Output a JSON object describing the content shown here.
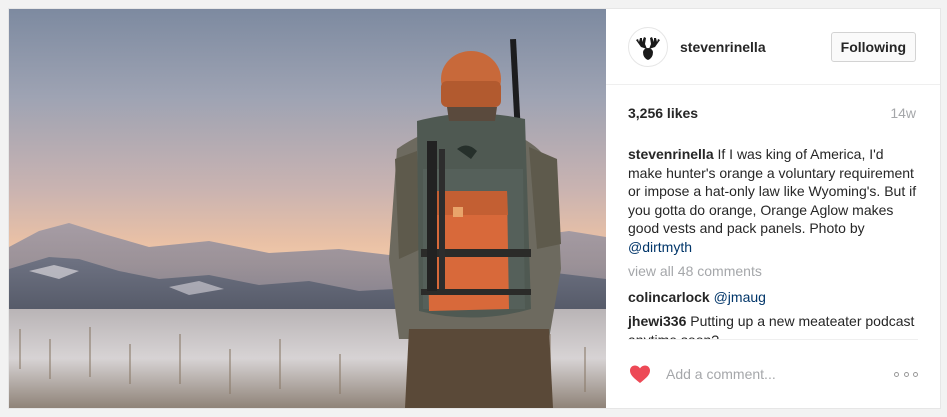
{
  "post": {
    "user": {
      "username": "stevenrinella",
      "avatar_icon": "moose-logo-icon"
    },
    "follow_label": "Following",
    "likes": "3,256 likes",
    "time_ago": "14w",
    "caption": {
      "user": "stevenrinella",
      "text": "If I was king of America, I'd make hunter's orange a voluntary requirement or impose a hat-only law like Wyoming's. But if you gotta do orange, Orange Aglow makes good vests and pack panels. Photo by ",
      "mention": "@dirtmyth"
    },
    "view_all_comments": "view all 48 comments",
    "comments": [
      {
        "user": "colincarlock",
        "text": "",
        "mention": "@jmaug"
      },
      {
        "user": "jhewi336",
        "text": "Putting up a new meateater podcast anytime soon?",
        "mention": ""
      }
    ],
    "add_comment_placeholder": "Add a comment...",
    "like_icon": "heart-icon",
    "more_icon": "more-options-icon",
    "colors": {
      "heart": "#ed4956",
      "mention": "#003569",
      "muted": "#a5a7aa"
    }
  }
}
